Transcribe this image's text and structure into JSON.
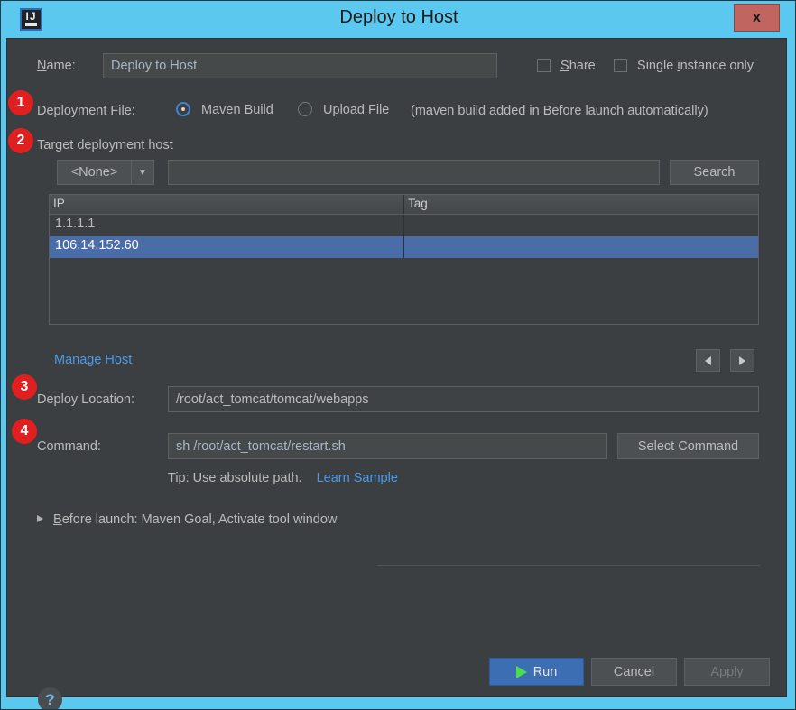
{
  "window": {
    "title": "Deploy to Host",
    "app_icon": "intellij-idea-icon",
    "close_label": "x"
  },
  "name_row": {
    "label_pre": "N",
    "label_mnemonic": "N",
    "label": "ame:",
    "label_full": "Name:",
    "value": "Deploy to Host",
    "share_label_pre": "",
    "share_label": "Share",
    "single_instance_label": "Single instance only",
    "share_checked": false,
    "single_instance_checked": false
  },
  "deployment_file": {
    "label": "Deployment File:",
    "options": [
      {
        "label": "Maven Build",
        "selected": true
      },
      {
        "label": "Upload File",
        "selected": false
      }
    ],
    "note": "(maven build added in Before launch automatically)"
  },
  "target_host": {
    "section_label": "Target deployment host",
    "filter_value": "<None>",
    "filter_caret": "▼",
    "search_value": "",
    "search_placeholder": "",
    "search_button": "Search",
    "columns": [
      "IP",
      "Tag"
    ],
    "rows": [
      {
        "ip": "1.1.1.1",
        "tag": "",
        "selected": false
      },
      {
        "ip": "106.14.152.60",
        "tag": "",
        "selected": true
      }
    ],
    "manage_host_link": "Manage Host",
    "prev_arrow": "◀",
    "next_arrow": "▶"
  },
  "deploy_location": {
    "label": "Deploy Location:",
    "value": "/root/act_tomcat/tomcat/webapps"
  },
  "command": {
    "label": "Command:",
    "value": "sh /root/act_tomcat/restart.sh",
    "button": "Select Command",
    "tip": "Tip: Use absolute path.",
    "tip_link": "Learn Sample"
  },
  "before_launch": {
    "label": "Before launch: Maven Goal, Activate tool window",
    "expanded": false
  },
  "footer": {
    "help": "?",
    "run": "Run",
    "cancel": "Cancel",
    "apply": "Apply",
    "apply_disabled": true
  },
  "badges": [
    "1",
    "2",
    "3",
    "4"
  ],
  "colors": {
    "titlebar": "#5bc8ef",
    "dialog_bg": "#3c3f41",
    "selection": "#4a6da7",
    "link": "#4b9ae8",
    "badge": "#e02020",
    "run_button": "#3c6eb4",
    "play_triangle": "#4ddb52",
    "close_button": "#c0655f"
  }
}
